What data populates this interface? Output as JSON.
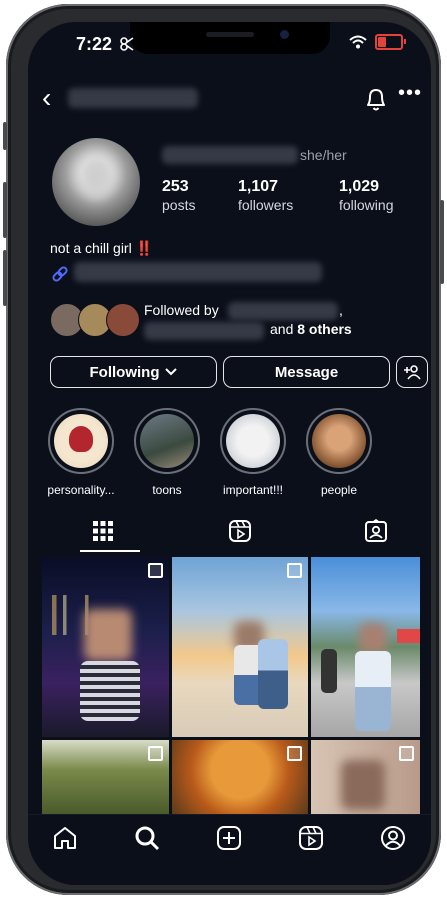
{
  "status": {
    "time": "7:22"
  },
  "profile": {
    "pronouns": "she/her",
    "bio": "not a chill girl",
    "bio_emoji": "‼️"
  },
  "stats": [
    {
      "num": "253",
      "label": "posts"
    },
    {
      "num": "1,107",
      "label": "followers"
    },
    {
      "num": "1,029",
      "label": "following"
    }
  ],
  "followed_by": {
    "prefix": "Followed by",
    "suffix_and": "and",
    "suffix_count": "8 others",
    "comma": ","
  },
  "buttons": {
    "following": "Following",
    "message": "Message"
  },
  "highlights": [
    {
      "label": "personality..."
    },
    {
      "label": "toons"
    },
    {
      "label": "important!!!"
    },
    {
      "label": "people"
    }
  ],
  "colors": {
    "background": "#0b0f1a",
    "accent_red": "#ff3040",
    "link_blue": "#4d6bff"
  }
}
